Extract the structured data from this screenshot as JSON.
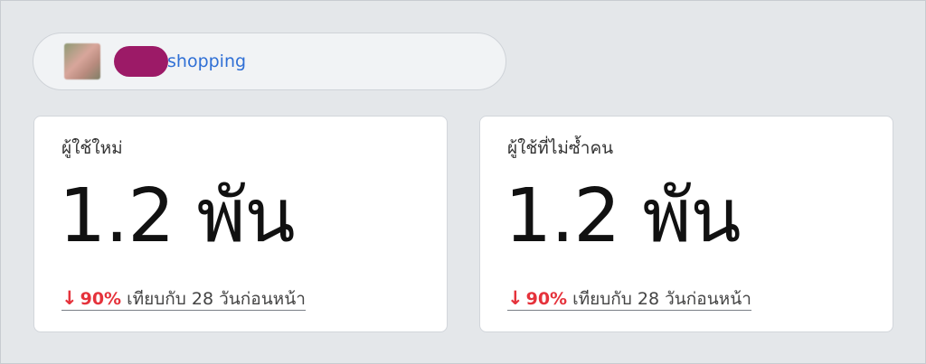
{
  "header": {
    "page_label": "shopping"
  },
  "cards": [
    {
      "title": "ผู้ใช้ใหม่",
      "value": "1.2 พัน",
      "change_arrow": "↓",
      "change_percent": "90%",
      "change_text": "เทียบกับ 28 วันก่อนหน้า",
      "change_color": "#e5323b"
    },
    {
      "title": "ผู้ใช้ที่ไม่ซ้ำคน",
      "value": "1.2 พัน",
      "change_arrow": "↓",
      "change_percent": "90%",
      "change_text": "เทียบกับ 28 วันก่อนหน้า",
      "change_color": "#e5323b"
    }
  ],
  "colors": {
    "background": "#e4e7ea",
    "link": "#2f6fd5",
    "redaction": "#9c1a67",
    "negative": "#e5323b"
  }
}
